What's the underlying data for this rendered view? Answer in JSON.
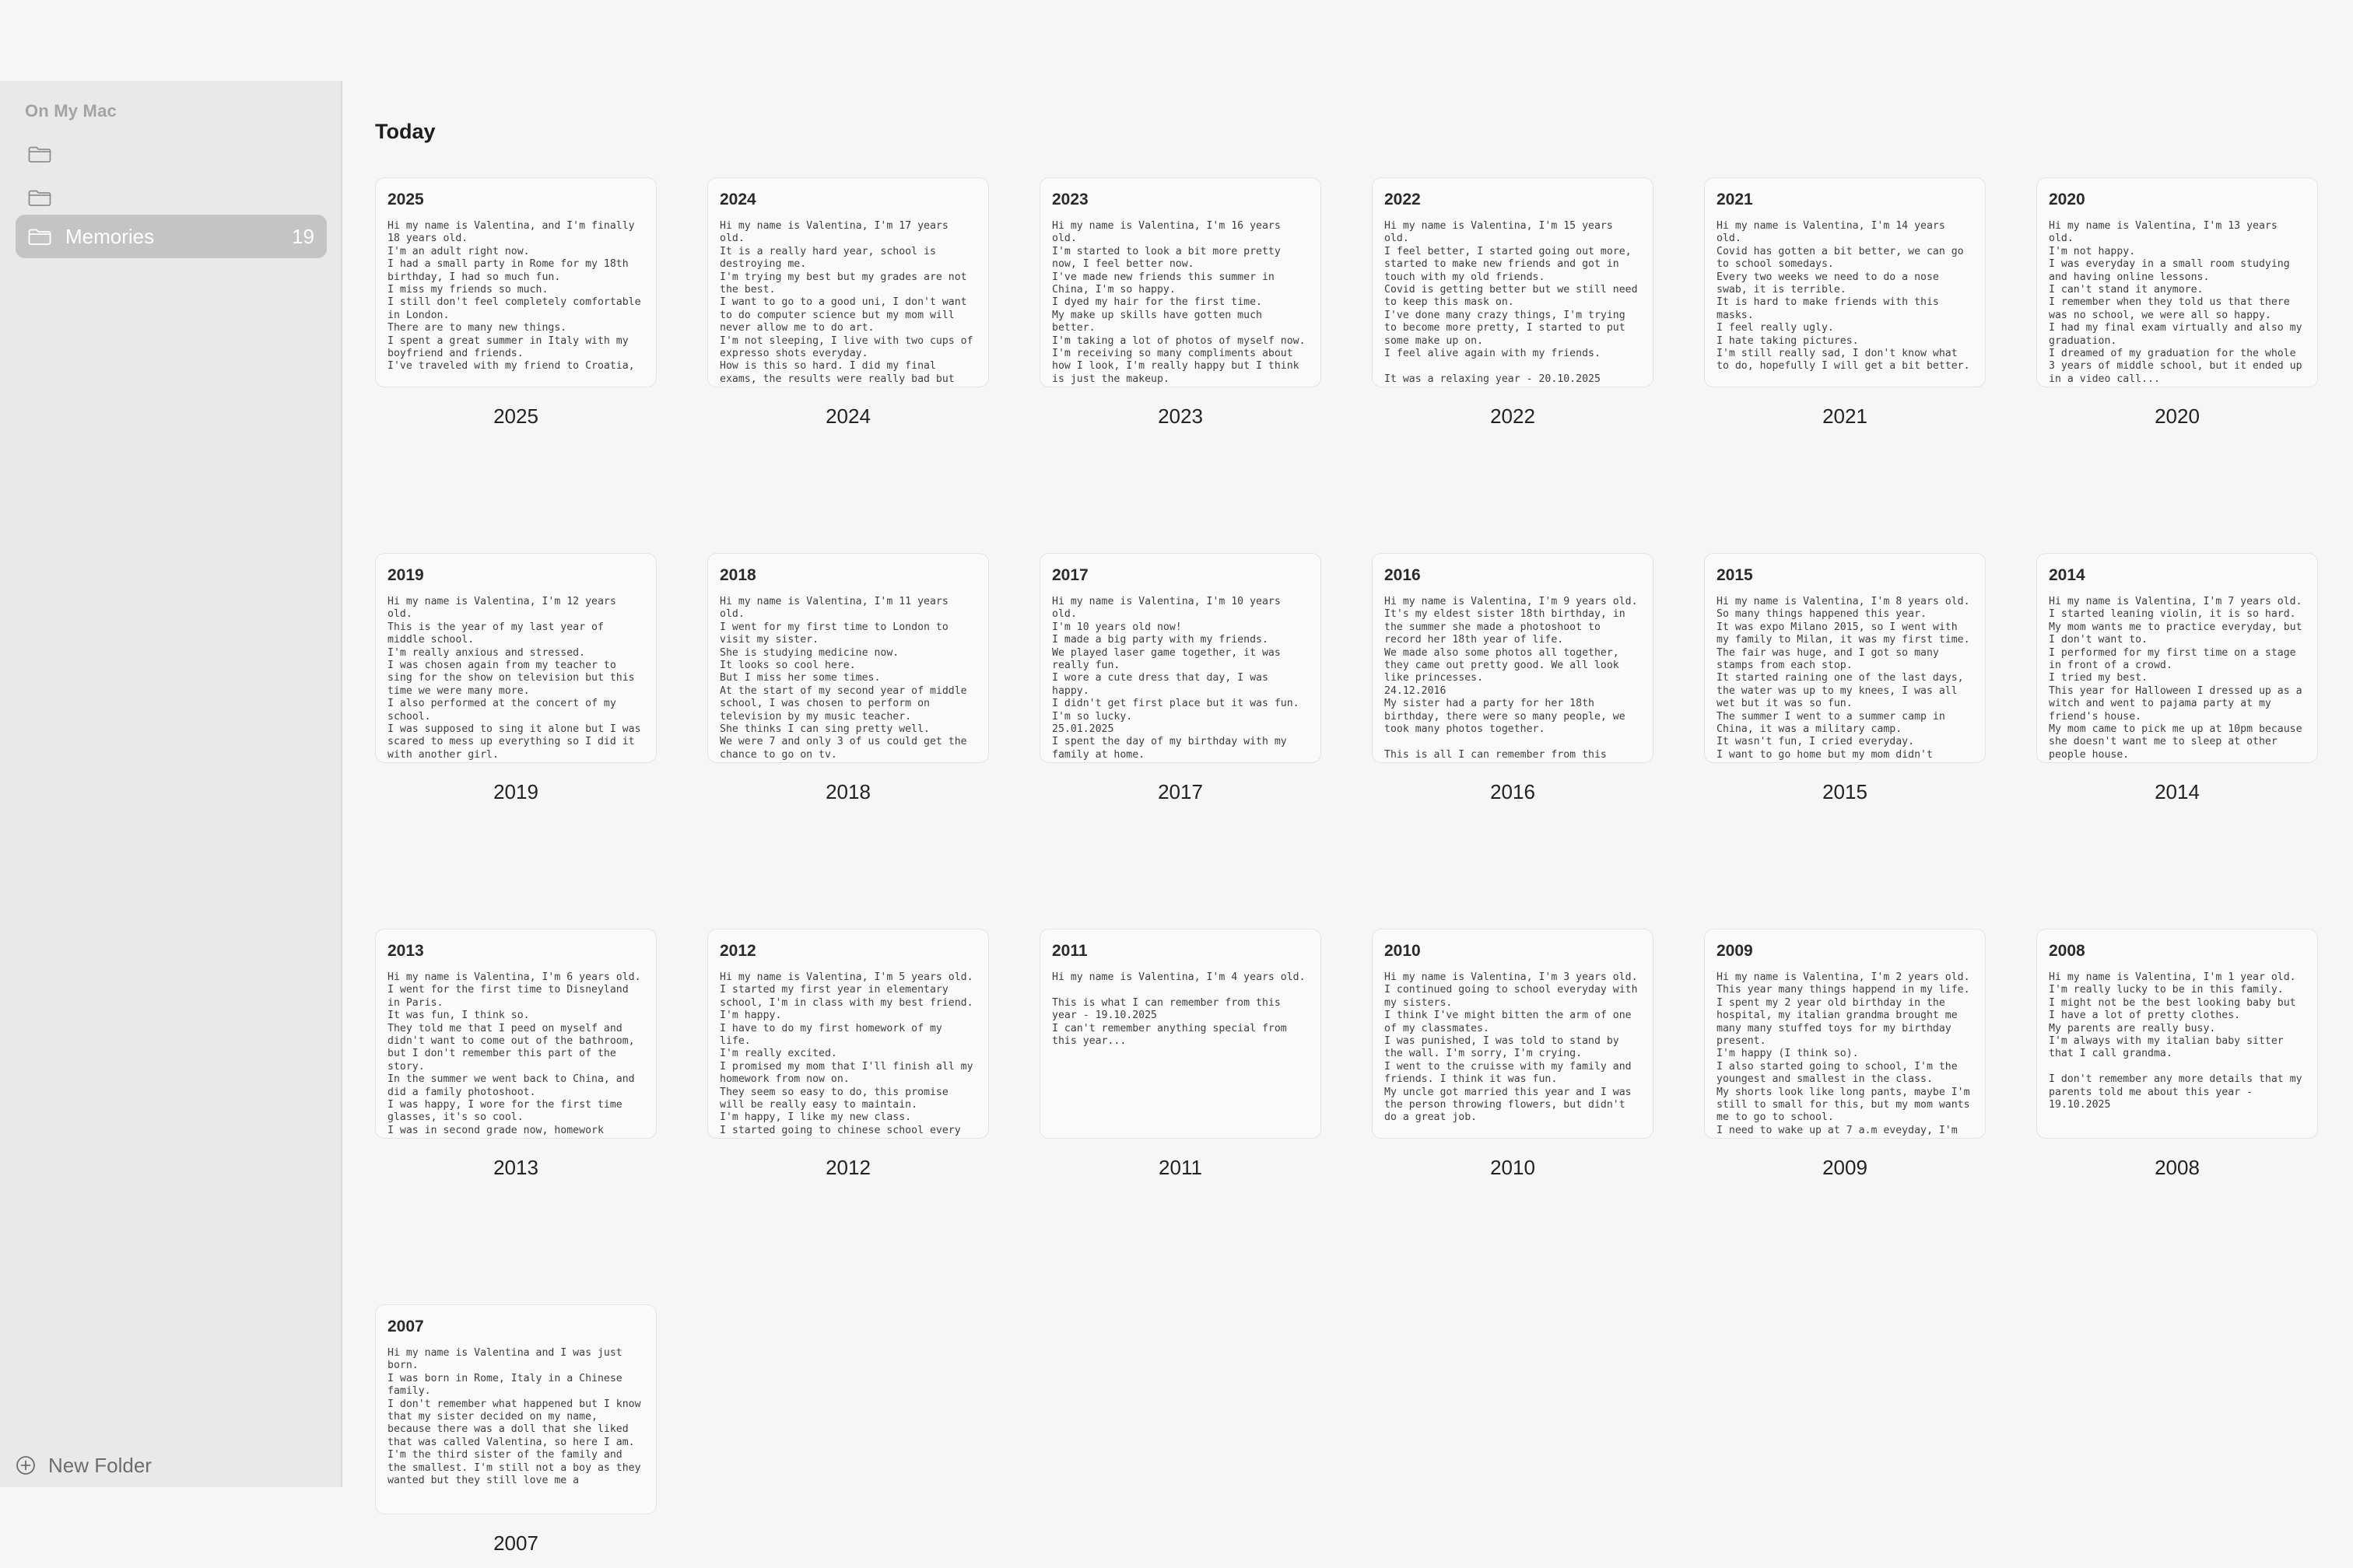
{
  "sidebar": {
    "section_label": "On My Mac",
    "folders": [
      {
        "label": "",
        "count": ""
      },
      {
        "label": "",
        "count": ""
      },
      {
        "label": "Memories",
        "count": "19"
      }
    ],
    "new_folder_label": "New Folder"
  },
  "main": {
    "section_title": "Today",
    "notes": [
      {
        "title": "2025",
        "label": "2025",
        "body": "Hi my name is Valentina, and I'm finally 18 years old.\nI'm an adult right now.\nI had a small party in Rome for my 18th birthday, I had so much fun.\nI miss my friends so much.\nI still don't feel completely comfortable in London.\nThere are to many new things.\nI spent a great summer in Italy with my boyfriend and friends.\nI've traveled with my friend to Croatia,"
      },
      {
        "title": "2024",
        "label": "2024",
        "body": "Hi my name is Valentina, I'm 17 years old.\nIt is a really hard year, school is destroying me.\nI'm trying my best but my grades are not the best.\nI want to go to a good uni, I don't want to do computer science but my mom will never allow me to do art.\nI'm not sleeping, I live with two cups of expresso shots everyday.\nHow is this so hard. I did my final exams, the results were really bad but"
      },
      {
        "title": "2023",
        "label": "2023",
        "body": "Hi my name is Valentina, I'm 16 years old.\nI'm started to look a bit more pretty now, I feel better now.\nI've made new friends this summer in China, I'm so happy.\nI dyed my hair for the first time.\nMy make up skills have gotten much better.\nI'm taking a lot of photos of myself now.\nI'm receiving so many compliments about how I look, I'm really happy but I think is just the makeup."
      },
      {
        "title": "2022",
        "label": "2022",
        "body": "Hi my name is Valentina, I'm 15 years old.\nI feel better, I started going out more, started to make new friends and got in touch with my old friends.\nCovid is getting better but we still need to keep this mask on.\nI've done many crazy things, I'm trying to become more pretty, I started to put some make up on.\nI feel alive again with my friends.\n\nIt was a relaxing year - 20.10.2025"
      },
      {
        "title": "2021",
        "label": "2021",
        "body": "Hi my name is Valentina, I'm 14 years old.\nCovid has gotten a bit better, we can go to school somedays.\nEvery two weeks we need to do a nose swab, it is terrible.\nIt is hard to make friends with this masks.\nI feel really ugly.\nI hate taking pictures.\nI'm still really sad, I don't know what to do, hopefully I will get a bit better."
      },
      {
        "title": "2020",
        "label": "2020",
        "body": "Hi my name is Valentina, I'm 13 years old.\nI'm not happy.\nI was everyday in a small room studying and having online lessons.\nI can't stand it anymore.\nI remember when they told us that there was no school, we were all so happy.\nI had my final exam virtually and also my graduation.\nI dreamed of my graduation for the whole 3 years of middle school, but it ended up in a video call..."
      },
      {
        "title": "2019",
        "label": "2019",
        "body": "Hi my name is Valentina, I'm 12 years old.\nThis is the year of my last year of middle school.\nI'm really anxious and stressed.\nI was chosen again from my teacher to sing for the show on television but this time we were many more.\nI also performed at the concert of my school.\nI was supposed to sing it alone but I was scared to mess up everything so I did it with another girl."
      },
      {
        "title": "2018",
        "label": "2018",
        "body": "Hi my name is Valentina, I'm 11 years old.\nI went for my first time to London to visit my sister.\nShe is studying medicine now.\nIt looks so cool here.\nBut I miss her some times.\nAt the start of my second year of middle school, I was chosen to perform on television by my music teacher.\nShe thinks I can sing pretty well.\nWe were 7 and only 3 of us could get the chance to go on tv."
      },
      {
        "title": "2017",
        "label": "2017",
        "body": "Hi my name is Valentina, I'm 10 years old.\nI'm 10 years old now!\nI made a big party with my friends.\nWe played laser game together, it was really fun.\nI wore a cute dress that day, I was happy.\nI didn't get first place but it was fun.\nI'm so lucky.\n25.01.2025\nI spent the day of my birthday with my family at home."
      },
      {
        "title": "2016",
        "label": "2016",
        "body": "Hi my name is Valentina, I'm 9 years old.\nIt's my eldest sister 18th birthday, in the summer she made a photoshoot to record her 18th year of life.\nWe made also some photos all together, they came out pretty good. We all look like princesses.\n24.12.2016\nMy sister had a party for her 18th birthday, there were so many people, we took many photos together.\n\nThis is all I can remember from this"
      },
      {
        "title": "2015",
        "label": "2015",
        "body": "Hi my name is Valentina, I'm 8 years old.\nSo many things happened this year.\nIt was expo Milano 2015, so I went with my family to Milan, it was my first time.\nThe fair was huge, and I got so many stamps from each stop.\nIt started raining one of the last days, the water was up to my knees, I was all wet but it was so fun.\nThe summer I went to a summer camp in China, it was a military camp.\nIt wasn't fun, I cried everyday.\nI want to go home but my mom didn't"
      },
      {
        "title": "2014",
        "label": "2014",
        "body": "Hi my name is Valentina, I'm 7 years old.\nI started leaning violin, it is so hard.\nMy mom wants me to practice everyday, but I don't want to.\nI performed for my first time on a stage in front of a crowd.\nI tried my best.\nThis year for Halloween I dressed up as a witch and went to pajama party at my friend's house.\nMy mom came to pick me up at 10pm because she doesn't want me to sleep at other people house."
      },
      {
        "title": "2013",
        "label": "2013",
        "body": "Hi my name is Valentina, I'm 6 years old.\nI went for the first time to Disneyland in Paris.\nIt was fun, I think so.\nThey told me that I peed on myself and didn't want to come out of the bathroom, but I don't remember this part of the story.\nIn the summer we went back to China, and did a family photoshoot.\nI was happy, I wore for the first time glasses, it's so cool.\nI was in second grade now, homework"
      },
      {
        "title": "2012",
        "label": "2012",
        "body": "Hi my name is Valentina, I'm 5 years old.\nI started my first year in elementary school, I'm in class with my best friend.\nI'm happy.\nI have to do my first homework of my life.\nI'm really excited.\nI promised my mom that I'll finish all my homework from now on.\nThey seem so easy to do, this promise will be really easy to maintain.\nI'm happy, I like my new class.\nI started going to chinese school every"
      },
      {
        "title": "2011",
        "label": "2011",
        "body": "Hi my name is Valentina, I'm 4 years old.\n\nThis is what I can remember from this year - 19.10.2025\nI can't remember anything special from this year..."
      },
      {
        "title": "2010",
        "label": "2010",
        "body": "Hi my name is Valentina, I'm 3 years old.\nI continued going to school everyday with my sisters.\nI think I've might bitten the arm of one of my classmates.\nI was punished, I was told to stand by the wall. I'm sorry, I'm crying.\nI went to the cruisse with my family and friends. I think it was fun.\nMy uncle got married this year and I was the person throwing flowers, but didn't do a great job."
      },
      {
        "title": "2009",
        "label": "2009",
        "body": "Hi my name is Valentina, I'm 2 years old.\nThis year many things happend in my life.\nI spent my 2 year old birthday in the hospital, my italian grandma brought me many many stuffed toys for my birthday present.\nI'm happy (I think so).\nI also started going to school, I'm the youngest and smallest in the class.\nMy shorts look like long pants, maybe I'm still to small for this, but my mom wants me to go to school.\nI need to wake up at 7 a.m eveyday, I'm"
      },
      {
        "title": "2008",
        "label": "2008",
        "body": "Hi my name is Valentina, I'm 1 year old.\nI'm really lucky to be in this family.\nI might not be the best looking baby but I have a lot of pretty clothes.\nMy parents are really busy.\nI'm always with my italian baby sitter that I call grandma.\n\nI don't remember any more details that my parents told me about this year - 19.10.2025"
      },
      {
        "title": "2007",
        "label": "2007",
        "body": "Hi my name is Valentina and I was just born.\nI was born in Rome, Italy in a Chinese family.\nI don't remember what happened but I know that my sister decided on my name, because there was a doll that she liked that was called Valentina, so here I am.\nI'm the third sister of the family and the smallest. I'm still not a boy as they wanted but they still love me a"
      }
    ]
  },
  "icons": {
    "folder": "folder-icon",
    "new_folder": "plus-circle-icon"
  },
  "colors": {
    "sidebar_bg": "#e9e9e9",
    "selected_row": "#c4c4c4",
    "page_bg": "#f6f6f6"
  }
}
